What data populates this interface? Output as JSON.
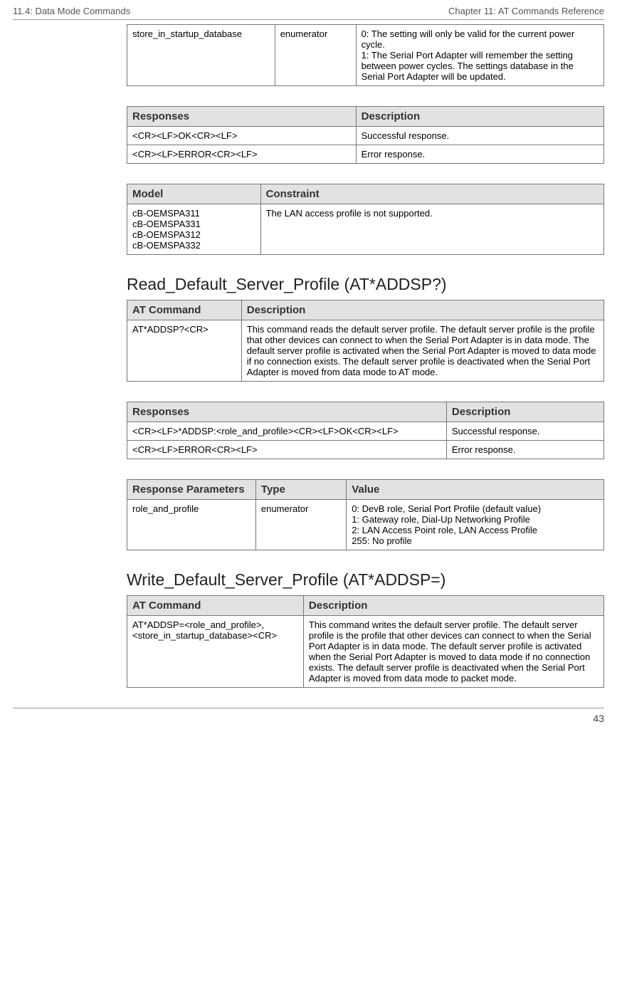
{
  "header": {
    "left": "11.4: Data Mode Commands",
    "right": "Chapter 11: AT Commands Reference"
  },
  "footer": {
    "page": "43"
  },
  "table1": {
    "rows": [
      {
        "c1": "store_in_startup_database",
        "c2": "enumerator",
        "c3": "0: The setting will only be valid for the current power cycle.\n1: The Serial Port Adapter will remember the setting between power cycles. The settings database in the Serial Port Adapter will be updated."
      }
    ]
  },
  "table2": {
    "h1": "Responses",
    "h2": "Description",
    "rows": [
      {
        "c1": "<CR><LF>OK<CR><LF>",
        "c2": "Successful response."
      },
      {
        "c1": "<CR><LF>ERROR<CR><LF>",
        "c2": "Error response."
      }
    ]
  },
  "table3": {
    "h1": "Model",
    "h2": "Constraint",
    "rows": [
      {
        "c1": "cB-OEMSPA311\ncB-OEMSPA331\ncB-OEMSPA312\ncB-OEMSPA332",
        "c2": "The LAN access profile is not supported."
      }
    ]
  },
  "section1_title": "Read_Default_Server_Profile (AT*ADDSP?)",
  "table4": {
    "h1": "AT Command",
    "h2": "Description",
    "rows": [
      {
        "c1": "AT*ADDSP?<CR>",
        "c2": "This command reads the default server profile. The default server profile is the profile that other devices can connect to when the Serial Port Adapter is in data mode. The default server profile is activated when the Serial Port Adapter is moved to data mode if no connection exists. The default server profile is deactivated when the Serial Port Adapter is moved from data mode to AT mode."
      }
    ]
  },
  "table5": {
    "h1": "Responses",
    "h2": "Description",
    "rows": [
      {
        "c1": "<CR><LF>*ADDSP:<role_and_profile><CR><LF>OK<CR><LF>",
        "c2": "Successful response."
      },
      {
        "c1": "<CR><LF>ERROR<CR><LF>",
        "c2": "Error response."
      }
    ]
  },
  "table6": {
    "h1": "Response Parameters",
    "h2": "Type",
    "h3": "Value",
    "rows": [
      {
        "c1": "role_and_profile",
        "c2": "enumerator",
        "c3": "0: DevB role, Serial Port Profile (default value)\n1: Gateway role, Dial-Up Networking Profile\n2: LAN Access Point role, LAN Access Profile\n255: No profile"
      }
    ]
  },
  "section2_title": "Write_Default_Server_Profile (AT*ADDSP=)",
  "table7": {
    "h1": "AT Command",
    "h2": "Description",
    "rows": [
      {
        "c1": "AT*ADDSP=<role_and_profile>, <store_in_startup_database><CR>",
        "c2": "This command writes the default server profile. The default server profile is the profile that other devices can connect to when the Serial Port Adapter is in data mode. The default server profile is activated when the Serial Port Adapter is moved to data mode if no connection exists. The default server profile is deactivated when the Serial Port Adapter is moved from data mode to packet mode."
      }
    ]
  }
}
